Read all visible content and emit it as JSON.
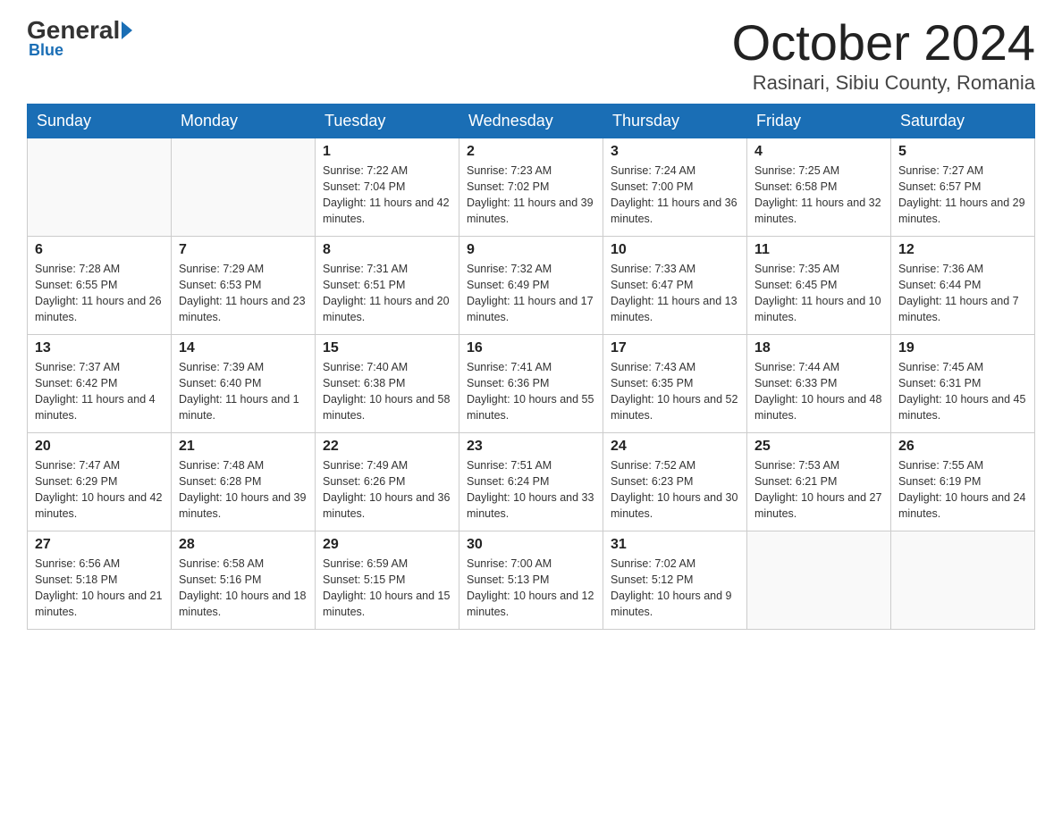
{
  "header": {
    "logo": {
      "general": "General",
      "blue": "Blue"
    },
    "month_title": "October 2024",
    "location": "Rasinari, Sibiu County, Romania"
  },
  "days_of_week": [
    "Sunday",
    "Monday",
    "Tuesday",
    "Wednesday",
    "Thursday",
    "Friday",
    "Saturday"
  ],
  "weeks": [
    [
      {
        "day": "",
        "sunrise": "",
        "sunset": "",
        "daylight": ""
      },
      {
        "day": "",
        "sunrise": "",
        "sunset": "",
        "daylight": ""
      },
      {
        "day": "1",
        "sunrise": "Sunrise: 7:22 AM",
        "sunset": "Sunset: 7:04 PM",
        "daylight": "Daylight: 11 hours and 42 minutes."
      },
      {
        "day": "2",
        "sunrise": "Sunrise: 7:23 AM",
        "sunset": "Sunset: 7:02 PM",
        "daylight": "Daylight: 11 hours and 39 minutes."
      },
      {
        "day": "3",
        "sunrise": "Sunrise: 7:24 AM",
        "sunset": "Sunset: 7:00 PM",
        "daylight": "Daylight: 11 hours and 36 minutes."
      },
      {
        "day": "4",
        "sunrise": "Sunrise: 7:25 AM",
        "sunset": "Sunset: 6:58 PM",
        "daylight": "Daylight: 11 hours and 32 minutes."
      },
      {
        "day": "5",
        "sunrise": "Sunrise: 7:27 AM",
        "sunset": "Sunset: 6:57 PM",
        "daylight": "Daylight: 11 hours and 29 minutes."
      }
    ],
    [
      {
        "day": "6",
        "sunrise": "Sunrise: 7:28 AM",
        "sunset": "Sunset: 6:55 PM",
        "daylight": "Daylight: 11 hours and 26 minutes."
      },
      {
        "day": "7",
        "sunrise": "Sunrise: 7:29 AM",
        "sunset": "Sunset: 6:53 PM",
        "daylight": "Daylight: 11 hours and 23 minutes."
      },
      {
        "day": "8",
        "sunrise": "Sunrise: 7:31 AM",
        "sunset": "Sunset: 6:51 PM",
        "daylight": "Daylight: 11 hours and 20 minutes."
      },
      {
        "day": "9",
        "sunrise": "Sunrise: 7:32 AM",
        "sunset": "Sunset: 6:49 PM",
        "daylight": "Daylight: 11 hours and 17 minutes."
      },
      {
        "day": "10",
        "sunrise": "Sunrise: 7:33 AM",
        "sunset": "Sunset: 6:47 PM",
        "daylight": "Daylight: 11 hours and 13 minutes."
      },
      {
        "day": "11",
        "sunrise": "Sunrise: 7:35 AM",
        "sunset": "Sunset: 6:45 PM",
        "daylight": "Daylight: 11 hours and 10 minutes."
      },
      {
        "day": "12",
        "sunrise": "Sunrise: 7:36 AM",
        "sunset": "Sunset: 6:44 PM",
        "daylight": "Daylight: 11 hours and 7 minutes."
      }
    ],
    [
      {
        "day": "13",
        "sunrise": "Sunrise: 7:37 AM",
        "sunset": "Sunset: 6:42 PM",
        "daylight": "Daylight: 11 hours and 4 minutes."
      },
      {
        "day": "14",
        "sunrise": "Sunrise: 7:39 AM",
        "sunset": "Sunset: 6:40 PM",
        "daylight": "Daylight: 11 hours and 1 minute."
      },
      {
        "day": "15",
        "sunrise": "Sunrise: 7:40 AM",
        "sunset": "Sunset: 6:38 PM",
        "daylight": "Daylight: 10 hours and 58 minutes."
      },
      {
        "day": "16",
        "sunrise": "Sunrise: 7:41 AM",
        "sunset": "Sunset: 6:36 PM",
        "daylight": "Daylight: 10 hours and 55 minutes."
      },
      {
        "day": "17",
        "sunrise": "Sunrise: 7:43 AM",
        "sunset": "Sunset: 6:35 PM",
        "daylight": "Daylight: 10 hours and 52 minutes."
      },
      {
        "day": "18",
        "sunrise": "Sunrise: 7:44 AM",
        "sunset": "Sunset: 6:33 PM",
        "daylight": "Daylight: 10 hours and 48 minutes."
      },
      {
        "day": "19",
        "sunrise": "Sunrise: 7:45 AM",
        "sunset": "Sunset: 6:31 PM",
        "daylight": "Daylight: 10 hours and 45 minutes."
      }
    ],
    [
      {
        "day": "20",
        "sunrise": "Sunrise: 7:47 AM",
        "sunset": "Sunset: 6:29 PM",
        "daylight": "Daylight: 10 hours and 42 minutes."
      },
      {
        "day": "21",
        "sunrise": "Sunrise: 7:48 AM",
        "sunset": "Sunset: 6:28 PM",
        "daylight": "Daylight: 10 hours and 39 minutes."
      },
      {
        "day": "22",
        "sunrise": "Sunrise: 7:49 AM",
        "sunset": "Sunset: 6:26 PM",
        "daylight": "Daylight: 10 hours and 36 minutes."
      },
      {
        "day": "23",
        "sunrise": "Sunrise: 7:51 AM",
        "sunset": "Sunset: 6:24 PM",
        "daylight": "Daylight: 10 hours and 33 minutes."
      },
      {
        "day": "24",
        "sunrise": "Sunrise: 7:52 AM",
        "sunset": "Sunset: 6:23 PM",
        "daylight": "Daylight: 10 hours and 30 minutes."
      },
      {
        "day": "25",
        "sunrise": "Sunrise: 7:53 AM",
        "sunset": "Sunset: 6:21 PM",
        "daylight": "Daylight: 10 hours and 27 minutes."
      },
      {
        "day": "26",
        "sunrise": "Sunrise: 7:55 AM",
        "sunset": "Sunset: 6:19 PM",
        "daylight": "Daylight: 10 hours and 24 minutes."
      }
    ],
    [
      {
        "day": "27",
        "sunrise": "Sunrise: 6:56 AM",
        "sunset": "Sunset: 5:18 PM",
        "daylight": "Daylight: 10 hours and 21 minutes."
      },
      {
        "day": "28",
        "sunrise": "Sunrise: 6:58 AM",
        "sunset": "Sunset: 5:16 PM",
        "daylight": "Daylight: 10 hours and 18 minutes."
      },
      {
        "day": "29",
        "sunrise": "Sunrise: 6:59 AM",
        "sunset": "Sunset: 5:15 PM",
        "daylight": "Daylight: 10 hours and 15 minutes."
      },
      {
        "day": "30",
        "sunrise": "Sunrise: 7:00 AM",
        "sunset": "Sunset: 5:13 PM",
        "daylight": "Daylight: 10 hours and 12 minutes."
      },
      {
        "day": "31",
        "sunrise": "Sunrise: 7:02 AM",
        "sunset": "Sunset: 5:12 PM",
        "daylight": "Daylight: 10 hours and 9 minutes."
      },
      {
        "day": "",
        "sunrise": "",
        "sunset": "",
        "daylight": ""
      },
      {
        "day": "",
        "sunrise": "",
        "sunset": "",
        "daylight": ""
      }
    ]
  ]
}
